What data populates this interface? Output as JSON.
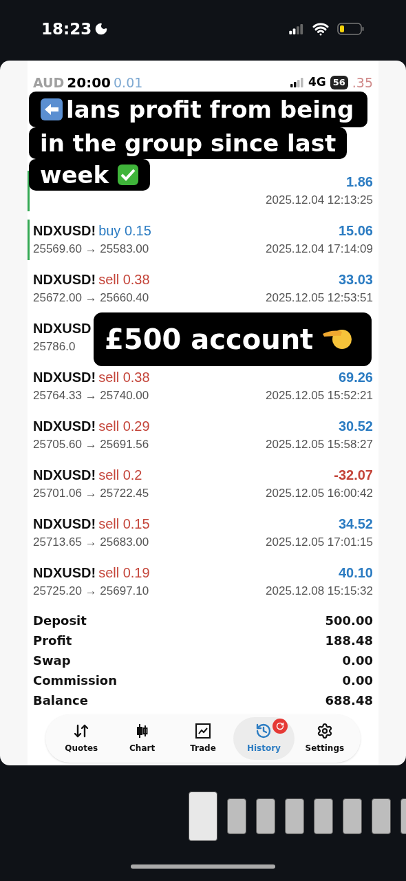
{
  "phone_status": {
    "time": "18:23"
  },
  "screenshot_status": {
    "time": "20:00",
    "network": "4G",
    "battery": "56",
    "behind_left": "AUD",
    "behind_volume": "0.01",
    "behind_right": ".35"
  },
  "trades": [
    {
      "marked": true,
      "profit": "1.86",
      "time": "2025.12.04 12:13:25",
      "loss": false
    },
    {
      "marked": true,
      "symbol": "NDXUSD!",
      "kind": "buy",
      "order": "buy 0.15",
      "prices": "25569.60 → 25583.00",
      "profit": "15.06",
      "time": "2025.12.04 17:14:09",
      "loss": false
    },
    {
      "marked": false,
      "symbol": "NDXUSD!",
      "kind": "sell",
      "order": "sell 0.38",
      "prices": "25672.00 → 25660.40",
      "profit": "33.03",
      "time": "2025.12.05 12:53:51",
      "loss": false
    },
    {
      "marked": false,
      "symbol": "NDXUSD",
      "prices": "25786.0"
    },
    {
      "marked": false,
      "symbol": "NDXUSD!",
      "kind": "sell",
      "order": "sell 0.38",
      "prices": "25764.33 → 25740.00",
      "profit": "69.26",
      "time": "2025.12.05 15:52:21",
      "loss": false
    },
    {
      "marked": false,
      "symbol": "NDXUSD!",
      "kind": "sell",
      "order": "sell 0.29",
      "prices": "25705.60 → 25691.56",
      "profit": "30.52",
      "time": "2025.12.05 15:58:27",
      "loss": false
    },
    {
      "marked": false,
      "symbol": "NDXUSD!",
      "kind": "sell",
      "order": "sell 0.2",
      "prices": "25701.06 → 25722.45",
      "profit": "-32.07",
      "time": "2025.12.05 16:00:42",
      "loss": true
    },
    {
      "marked": false,
      "symbol": "NDXUSD!",
      "kind": "sell",
      "order": "sell 0.15",
      "prices": "25713.65 → 25683.00",
      "profit": "34.52",
      "time": "2025.12.05 17:01:15",
      "loss": false
    },
    {
      "marked": false,
      "symbol": "NDXUSD!",
      "kind": "sell",
      "order": "sell 0.19",
      "prices": "25725.20 → 25697.10",
      "profit": "40.10",
      "time": "2025.12.08 15:15:32",
      "loss": false
    }
  ],
  "summary": [
    {
      "label": "Deposit",
      "value": "500.00"
    },
    {
      "label": "Profit",
      "value": "188.48"
    },
    {
      "label": "Swap",
      "value": "0.00"
    },
    {
      "label": "Commission",
      "value": "0.00"
    },
    {
      "label": "Balance",
      "value": "688.48"
    }
  ],
  "nav": [
    {
      "label": "Quotes",
      "selected": false
    },
    {
      "label": "Chart",
      "selected": false
    },
    {
      "label": "Trade",
      "selected": false
    },
    {
      "label": "History",
      "selected": true,
      "badge": true
    },
    {
      "label": "Settings",
      "selected": false
    }
  ],
  "caption_top": {
    "lines": [
      "lans profit from being",
      "in the group since last",
      "week"
    ]
  },
  "caption_middle": {
    "text": "£500 account"
  },
  "thumbnails": [
    {
      "selected": true
    },
    {
      "selected": false
    },
    {
      "selected": false
    },
    {
      "selected": false
    },
    {
      "selected": false
    },
    {
      "selected": false
    },
    {
      "selected": false
    },
    {
      "selected": false
    }
  ]
}
